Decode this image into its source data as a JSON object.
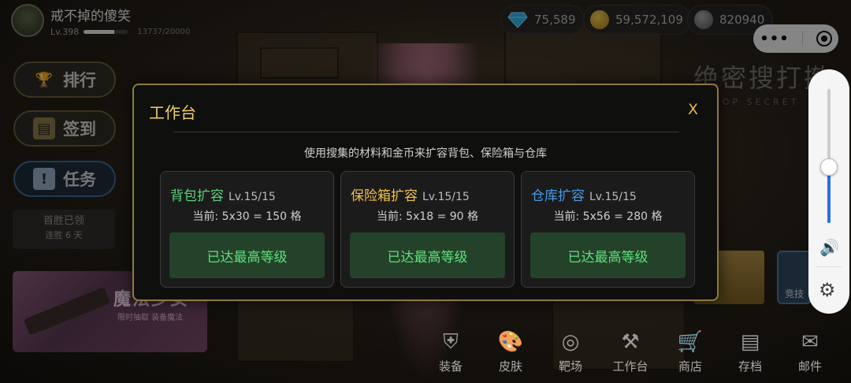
{
  "player": {
    "name": "戒不掉的傻笑",
    "level": "Lv.398",
    "xp_text": "13737/20000",
    "xp_fraction": 0.687
  },
  "currencies": [
    {
      "icon": "diamond-icon",
      "value": "75,589",
      "color": "#3bb8e8"
    },
    {
      "icon": "gold-coin-icon",
      "value": "59,572,109",
      "color": "#d8a42a"
    },
    {
      "icon": "silver-coin-icon",
      "value": "820940",
      "color": "#8a8a8a"
    }
  ],
  "side_menu": {
    "rank": "排行",
    "checkin": "签到",
    "task": "任务",
    "first_win": "首胜已领",
    "streak": "连胜 6 天"
  },
  "promo": {
    "title": "魔法少女",
    "subtitle": "限时抽取 装备魔法"
  },
  "scene": {
    "title": "绝密搜打撤",
    "subtitle": "TOP SECRET"
  },
  "side_panel": {
    "volume_level": 0.42
  },
  "right_button": {
    "label": "竞技"
  },
  "bottom_nav": [
    {
      "icon": "equipment-shield-icon",
      "label": "装备",
      "glyph": "⛨"
    },
    {
      "icon": "skin-palette-icon",
      "label": "皮肤",
      "glyph": "🎨"
    },
    {
      "icon": "range-target-icon",
      "label": "靶场",
      "glyph": "◎"
    },
    {
      "icon": "workbench-tools-icon",
      "label": "工作台",
      "glyph": "⚒"
    },
    {
      "icon": "shop-cart-icon",
      "label": "商店",
      "glyph": "🛒"
    },
    {
      "icon": "archive-icon",
      "label": "存档",
      "glyph": "▤"
    },
    {
      "icon": "mail-icon",
      "label": "邮件",
      "glyph": "✉"
    }
  ],
  "modal": {
    "title": "工作台",
    "close": "X",
    "description": "使用搜集的材料和金币来扩容背包、保险箱与仓库",
    "cards": [
      {
        "name": "背包扩容",
        "level": "Lv.15/15",
        "current": "当前: 5x30 = 150 格",
        "button": "已达最高等级",
        "color": "#5fd07a"
      },
      {
        "name": "保险箱扩容",
        "level": "Lv.15/15",
        "current": "当前: 5x18 = 90 格",
        "button": "已达最高等级",
        "color": "#f0c04a"
      },
      {
        "name": "仓库扩容",
        "level": "Lv.15/15",
        "current": "当前: 5x56 = 280 格",
        "button": "已达最高等级",
        "color": "#4a9ae8"
      }
    ]
  }
}
